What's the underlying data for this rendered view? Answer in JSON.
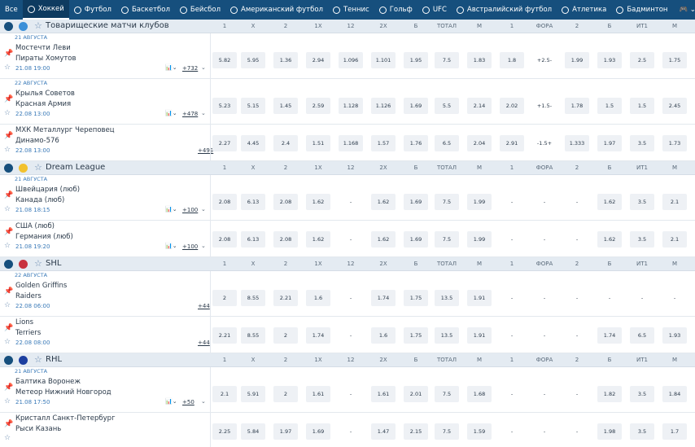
{
  "nav": [
    {
      "label": "Все",
      "icon": "none"
    },
    {
      "label": "Хоккей",
      "icon": "hockey-puck-icon",
      "active": true
    },
    {
      "label": "Футбол",
      "icon": "soccer-ball-icon"
    },
    {
      "label": "Баскетбол",
      "icon": "basketball-icon"
    },
    {
      "label": "Бейсбол",
      "icon": "baseball-icon"
    },
    {
      "label": "Американский футбол",
      "icon": "american-football-icon"
    },
    {
      "label": "Теннис",
      "icon": "tennis-ball-icon"
    },
    {
      "label": "Гольф",
      "icon": "golf-icon"
    },
    {
      "label": "UFC",
      "icon": "ufc-icon"
    },
    {
      "label": "Австралийский футбол",
      "icon": "aussie-rules-icon"
    },
    {
      "label": "Атлетика",
      "icon": "athletics-icon"
    },
    {
      "label": "Бадминтон",
      "icon": "badminton-icon"
    }
  ],
  "more_icon": "gamepad-chevron-icon",
  "columns": [
    "1",
    "X",
    "2",
    "1X",
    "12",
    "2X",
    "Б",
    "ТОТАЛ",
    "М",
    "1",
    "ФОРА",
    "2",
    "Б",
    "ИТ1",
    "М"
  ],
  "leagues": [
    {
      "name": "Товарищеские матчи клубов",
      "icon1": "hockey-puck-icon",
      "icon2": "globe-icon",
      "groups": [
        {
          "date": "21 АВГУСТА",
          "matches": [
            {
              "team1": "Мостечти Леви",
              "team2": "Пираты Хомутов",
              "time": "21.08 19:00",
              "stats": true,
              "plus": "+732",
              "odds": [
                "5.82",
                "5.95",
                "1.36",
                "2.94",
                "1.096",
                "1.101",
                "1.95",
                "7.5",
                "1.83",
                "1.8",
                "+2.5-",
                "1.99",
                "1.93",
                "2.5",
                "1.75"
              ]
            }
          ]
        },
        {
          "date": "22 АВГУСТА",
          "matches": [
            {
              "team1": "Крылья Советов",
              "team2": "Красная Армия",
              "time": "22.08 13:00",
              "stats": true,
              "plus": "+478",
              "odds": [
                "5.23",
                "5.15",
                "1.45",
                "2.59",
                "1.128",
                "1.126",
                "1.69",
                "5.5",
                "2.14",
                "2.02",
                "+1.5-",
                "1.78",
                "1.5",
                "1.5",
                "2.45"
              ]
            },
            {
              "team1": "МХК Металлург Череповец",
              "team2": "Динамо-576",
              "time": "22.08 13:00",
              "stats": false,
              "plus": "+499",
              "odds": [
                "2.27",
                "4.45",
                "2.4",
                "1.51",
                "1.168",
                "1.57",
                "1.76",
                "6.5",
                "2.04",
                "2.91",
                "-1.5+",
                "1.333",
                "1.97",
                "3.5",
                "1.73"
              ]
            }
          ]
        }
      ]
    },
    {
      "name": "Dream League",
      "icon1": "hockey-puck-icon",
      "icon2": "trophy-icon",
      "groups": [
        {
          "date": "21 АВГУСТА",
          "matches": [
            {
              "team1": "Швейцария (люб)",
              "team2": "Канада (люб)",
              "time": "21.08 18:15",
              "stats": true,
              "plus": "+100",
              "odds": [
                "2.08",
                "6.13",
                "2.08",
                "1.62",
                "-",
                "1.62",
                "1.69",
                "7.5",
                "1.99",
                "-",
                "-",
                "-",
                "1.62",
                "3.5",
                "2.1"
              ]
            },
            {
              "team1": "США (люб)",
              "team2": "Германия (люб)",
              "time": "21.08 19:20",
              "stats": true,
              "plus": "+100",
              "odds": [
                "2.08",
                "6.13",
                "2.08",
                "1.62",
                "-",
                "1.62",
                "1.69",
                "7.5",
                "1.99",
                "-",
                "-",
                "-",
                "1.62",
                "3.5",
                "2.1"
              ]
            }
          ]
        }
      ]
    },
    {
      "name": "SHL",
      "icon1": "hockey-puck-icon",
      "icon2": "flag-belarus-icon",
      "groups": [
        {
          "date": "22 АВГУСТА",
          "matches": [
            {
              "team1": "Golden Griffins",
              "team2": "Raiders",
              "time": "22.08 06:00",
              "stats": false,
              "plus": "+44",
              "odds": [
                "2",
                "8.55",
                "2.21",
                "1.6",
                "-",
                "1.74",
                "1.75",
                "13.5",
                "1.91",
                "-",
                "-",
                "-",
                "-",
                "-",
                "-"
              ]
            },
            {
              "team1": "Lions",
              "team2": "Terriers",
              "time": "22.08 08:00",
              "stats": false,
              "plus": "+44",
              "odds": [
                "2.21",
                "8.55",
                "2",
                "1.74",
                "-",
                "1.6",
                "1.75",
                "13.5",
                "1.91",
                "-",
                "-",
                "-",
                "1.74",
                "6.5",
                "1.93"
              ]
            }
          ]
        }
      ]
    },
    {
      "name": "RHL",
      "icon1": "hockey-puck-icon",
      "icon2": "flag-russia-icon",
      "groups": [
        {
          "date": "21 АВГУСТА",
          "matches": [
            {
              "team1": "Балтика Воронеж",
              "team2": "Метеор Нижний Новгород",
              "time": "21.08 17:50",
              "stats": true,
              "plus": "+50",
              "odds": [
                "2.1",
                "5.91",
                "2",
                "1.61",
                "-",
                "1.61",
                "2.01",
                "7.5",
                "1.68",
                "-",
                "-",
                "-",
                "1.82",
                "3.5",
                "1.84"
              ]
            },
            {
              "team1": "Кристалл Санкт-Петербург",
              "team2": "Рыси Казань",
              "time": "",
              "stats": false,
              "plus": "",
              "odds": [
                "2.25",
                "5.84",
                "1.97",
                "1.69",
                "-",
                "1.47",
                "2.15",
                "7.5",
                "1.59",
                "-",
                "-",
                "-",
                "1.98",
                "3.5",
                "1.7"
              ]
            }
          ]
        }
      ]
    }
  ]
}
